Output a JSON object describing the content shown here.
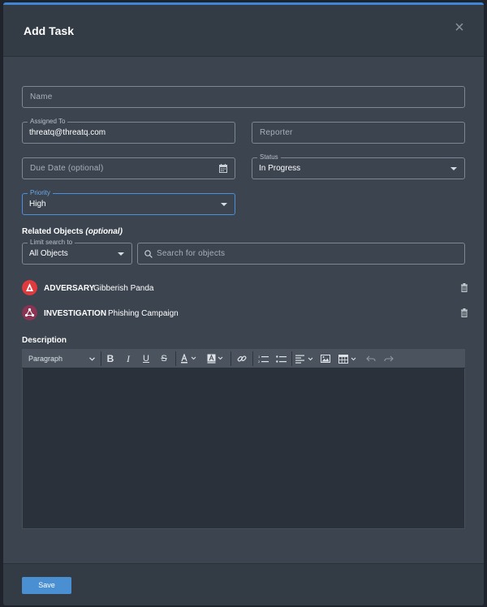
{
  "modal": {
    "title": "Add Task",
    "close_symbol": "×"
  },
  "fields": {
    "name": {
      "placeholder": "Name"
    },
    "assigned_to": {
      "label": "Assigned To",
      "value": "threatq@threatq.com"
    },
    "reporter": {
      "placeholder": "Reporter"
    },
    "due_date": {
      "placeholder": "Due Date (optional)"
    },
    "status": {
      "label": "Status",
      "value": "In Progress"
    },
    "priority": {
      "label": "Priority",
      "value": "High"
    }
  },
  "related_objects": {
    "heading": "Related Objects",
    "heading_optional": "(optional)",
    "limit_search": {
      "label": "Limit search to",
      "value": "All Objects"
    },
    "search": {
      "placeholder": "Search for objects"
    },
    "items": [
      {
        "type": "ADVERSARY",
        "name": "Gibberish Panda",
        "icon_color": "#e0393e",
        "icon": "adversary-icon"
      },
      {
        "type": "INVESTIGATION",
        "name": "Phishing Campaign",
        "icon_color": "#8a3453",
        "icon": "investigation-icon"
      }
    ]
  },
  "description": {
    "heading": "Description",
    "toolbar": {
      "block_format": "Paragraph",
      "bold": "B",
      "italic": "I",
      "underline": "U",
      "strikethrough": "S"
    }
  },
  "footer": {
    "save_label": "Save"
  },
  "colors": {
    "accent": "#3f86d6",
    "save_button": "#4a8fd2",
    "focus_border": "#4a8fe0"
  }
}
